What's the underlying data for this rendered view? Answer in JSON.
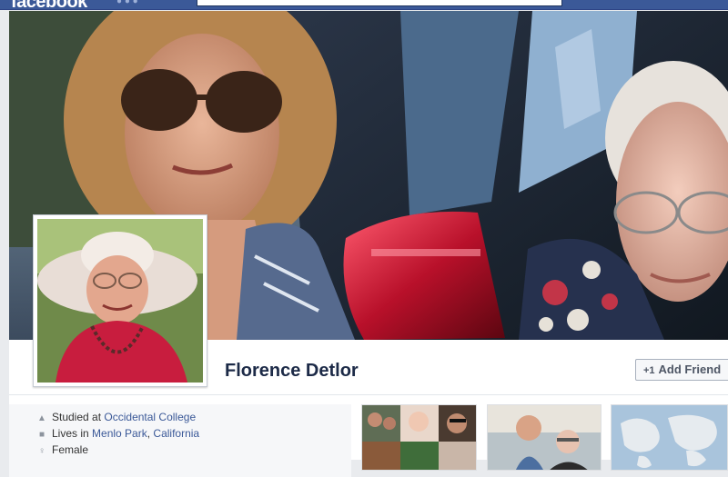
{
  "header": {
    "logo": "facebook"
  },
  "profile": {
    "name": "Florence Detlor",
    "add_friend_label": "Add Friend"
  },
  "info": {
    "studied_prefix": "Studied at",
    "studied_school": "Occidental College",
    "lives_prefix": "Lives in",
    "city": "Menlo Park",
    "state": "California",
    "gender": "Female"
  },
  "colors": {
    "brand_blue": "#3b5998",
    "link_blue": "#3b5998",
    "name_text": "#1c2a47"
  }
}
